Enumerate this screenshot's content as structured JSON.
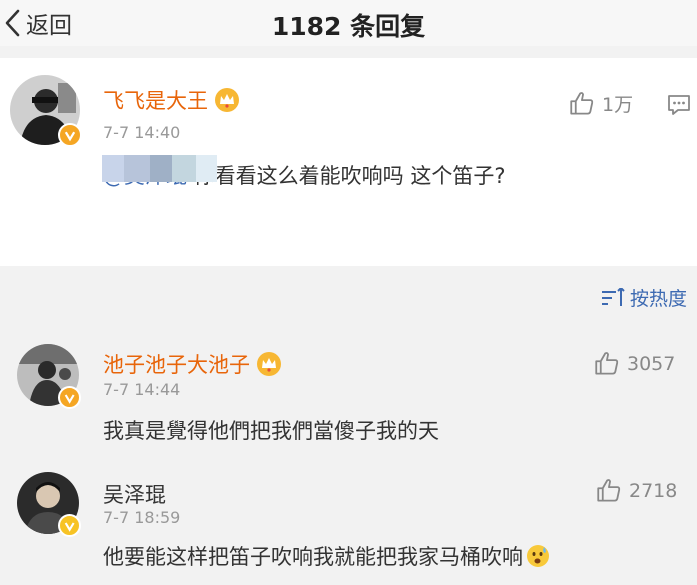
{
  "header": {
    "back_label": "返回",
    "title": "1182 条回复"
  },
  "post": {
    "author": "飞飞是大王",
    "time": "7-7 14:40",
    "likes": "1万",
    "mention": "@吴泽琨",
    "text": " 你看看这么着能吹响吗 这个笛子?"
  },
  "sort_label": "按热度",
  "replies": [
    {
      "author": "池子池子大池子",
      "time": "7-7 14:44",
      "likes": "3057",
      "text": "我真是覺得他們把我們當傻子我的天"
    },
    {
      "author": "吴泽琨",
      "time": "7-7 18:59",
      "likes": "2718",
      "text": "他要能这样把笛子吹响我就能把我家马桶吹响"
    }
  ],
  "colors": {
    "name_accent": "#e8650a",
    "link": "#3d6ab2",
    "badge": "#f5a623"
  }
}
